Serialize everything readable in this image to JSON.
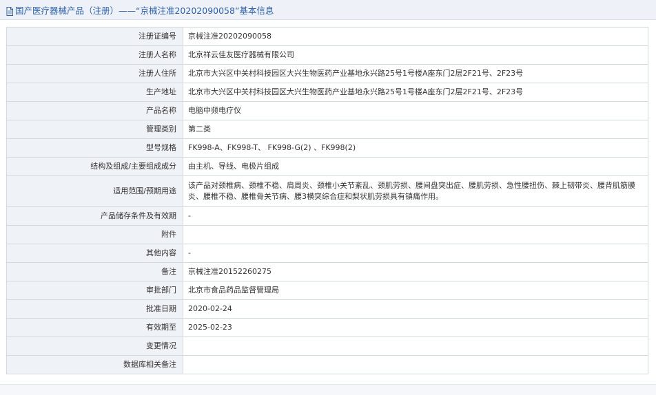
{
  "header": {
    "title": "国产医疗器械产品（注册）——“京械注准20202090058”基本信息"
  },
  "colors": {
    "title_text": "#2a5ea8",
    "header_bg": "#eef2f8",
    "label_bg": "#eff3f8",
    "border": "#d3d8e0"
  },
  "icons": {
    "title": "document-icon"
  },
  "rows": [
    {
      "label": "注册证编号",
      "value": "京械注准20202090058"
    },
    {
      "label": "注册人名称",
      "value": "北京祥云佳友医疗器械有限公司"
    },
    {
      "label": "注册人住所",
      "value": "北京市大兴区中关村科技园区大兴生物医药产业基地永兴路25号1号楼A座东门2层2F21号、2F23号"
    },
    {
      "label": "生产地址",
      "value": "北京市大兴区中关村科技园区大兴生物医药产业基地永兴路25号1号楼A座东门2层2F21号、2F23号"
    },
    {
      "label": "产品名称",
      "value": "电脑中频电疗仪"
    },
    {
      "label": "管理类别",
      "value": "第二类"
    },
    {
      "label": "型号规格",
      "value": "FK998-A、FK998-T、 FK998-G(2) 、FK998(2)"
    },
    {
      "label": "结构及组成/主要组成成分",
      "value": "由主机、导线、电极片组成"
    },
    {
      "label": "适用范围/预期用途",
      "value": "该产品对颈椎病、颈椎不稳、肩周炎、颈椎小关节紊乱、颈肌劳损、腰间盘突出症、腰肌劳损、急性腰扭伤、棘上韧带炎、腰背肌筋膜炎、腰椎不稳、腰椎骨关节病、腰3横突综合症和梨状肌劳损具有镇痛作用。"
    },
    {
      "label": "产品储存条件及有效期",
      "value": "-"
    },
    {
      "label": "附件",
      "value": ""
    },
    {
      "label": "其他内容",
      "value": "-"
    },
    {
      "label": "备注",
      "value": "京械注准20152260275"
    },
    {
      "label": "审批部门",
      "value": "北京市食品药品监督管理局"
    },
    {
      "label": "批准日期",
      "value": "2020-02-24"
    },
    {
      "label": "有效期至",
      "value": "2025-02-23"
    },
    {
      "label": "变更情况",
      "value": ""
    },
    {
      "label": "数据库相关备注",
      "value": ""
    }
  ]
}
